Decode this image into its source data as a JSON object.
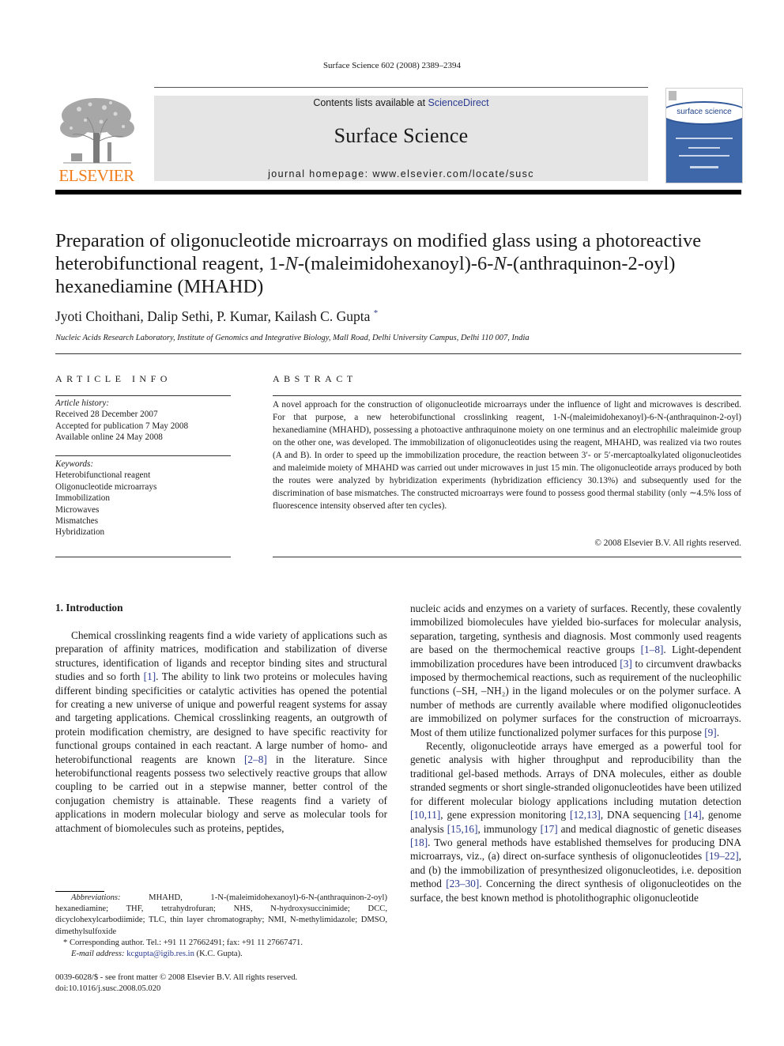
{
  "running_head": "Surface Science 602 (2008) 2389–2394",
  "banner": {
    "contents_prefix": "Contents lists available at ",
    "contents_link": "ScienceDirect",
    "journal_name": "Surface Science",
    "homepage": "journal homepage: www.elsevier.com/locate/susc"
  },
  "publisher_logo": {
    "word": "ELSEVIER",
    "icon": "elsevier-tree-icon",
    "color": "#f07d1a"
  },
  "cover": {
    "title": "surface science",
    "color": "#3d67a8"
  },
  "title_parts": {
    "a": "Preparation of oligonucleotide microarrays on modified glass using a photoreactive heterobifunctional reagent, 1-",
    "n1": "N",
    "b": "-(maleimidohexanoyl)-6-",
    "n2": "N",
    "c": "-(anthraquinon-2-oyl) hexanediamine (MHAHD)"
  },
  "authors": "Jyoti Choithani, Dalip Sethi, P. Kumar, Kailash C. Gupta",
  "author_mark": "*",
  "affiliation": "Nucleic Acids Research Laboratory, Institute of Genomics and Integrative Biology, Mall Road, Delhi University Campus, Delhi 110 007, India",
  "article_info": {
    "heading": "ARTICLE INFO",
    "history_label": "Article history:",
    "history": [
      "Received 28 December 2007",
      "Accepted for publication 7 May 2008",
      "Available online 24 May 2008"
    ],
    "keywords_label": "Keywords:",
    "keywords": [
      "Heterobifunctional reagent",
      "Oligonucleotide microarrays",
      "Immobilization",
      "Microwaves",
      "Mismatches",
      "Hybridization"
    ]
  },
  "abstract": {
    "heading": "ABSTRACT",
    "text": "A novel approach for the construction of oligonucleotide microarrays under the influence of light and microwaves is described. For that purpose, a new heterobifunctional crosslinking reagent, 1-N-(maleimidohexanoyl)-6-N-(anthraquinon-2-oyl) hexanediamine (MHAHD), possessing a photoactive anthraquinone moiety on one terminus and an electrophilic maleimide group on the other one, was developed. The immobilization of oligonucleotides using the reagent, MHAHD, was realized via two routes (A and B). In order to speed up the immobilization procedure, the reaction between 3′- or 5′-mercaptoalkylated oligonucleotides and maleimide moiety of MHAHD was carried out under microwaves in just 15 min. The oligonucleotide arrays produced by both the routes were analyzed by hybridization experiments (hybridization efficiency 30.13%) and subsequently used for the discrimination of base mismatches. The constructed microarrays were found to possess good thermal stability (only ∼4.5% loss of fluorescence intensity observed after ten cycles).",
    "copyright": "© 2008 Elsevier B.V. All rights reserved."
  },
  "introduction": {
    "heading": "1. Introduction",
    "p1": [
      {
        "t": "Chemical crosslinking reagents find a wide variety of applications such as preparation of affinity matrices, modification and stabilization of diverse structures, identification of ligands and receptor binding sites and structural studies and so forth "
      },
      {
        "ref": "[1]"
      },
      {
        "t": ". The ability to link two proteins or molecules having different binding specificities or catalytic activities has opened the potential for creating a new universe of unique and powerful reagent systems for assay and targeting applications. Chemical crosslinking reagents, an outgrowth of protein modification chemistry, are designed to have specific reactivity for functional groups contained in each reactant. A large number of homo- and heterobifunctional reagents are known "
      },
      {
        "ref": "[2–8]"
      },
      {
        "t": " in the literature. Since heterobifunctional reagents possess two selectively reactive groups that allow coupling to be carried out in a stepwise manner, better control of the conjugation chemistry is attainable. These reagents find a variety of applications in modern molecular biology and serve as molecular tools for attachment of biomolecules such as proteins, peptides, nucleic acids and enzymes on a variety of surfaces. Recently, these covalently immobilized biomolecules have yielded bio-surfaces for molecular analysis, separation, targeting, synthesis and diagnosis. Most commonly used reagents are based on the thermochemical reactive groups "
      },
      {
        "ref": "[1–8]"
      },
      {
        "t": ". Light-dependent immobilization procedures have been introduced "
      },
      {
        "ref": "[3]"
      },
      {
        "t": " to circumvent drawbacks imposed by thermochemical reactions, such as requirement of the nucleophilic functions (–SH, –NH₂) in the ligand molecules or on the polymer surface. A number of methods are currently available where modified oligonucleotides are immobilized on polymer surfaces for the construction of microarrays. Most of them utilize functionalized polymer surfaces for this purpose "
      },
      {
        "ref": "[9]"
      },
      {
        "t": "."
      }
    ],
    "p2": [
      {
        "t": "Recently, oligonucleotide arrays have emerged as a powerful tool for genetic analysis with higher throughput and reproducibility than the traditional gel-based methods. Arrays of DNA molecules, either as double stranded segments or short single-stranded oligonucleotides have been utilized for different molecular biology applications including mutation detection "
      },
      {
        "ref": "[10,11]"
      },
      {
        "t": ", gene expression monitoring "
      },
      {
        "ref": "[12,13]"
      },
      {
        "t": ", DNA sequencing "
      },
      {
        "ref": "[14]"
      },
      {
        "t": ", genome analysis "
      },
      {
        "ref": "[15,16]"
      },
      {
        "t": ", immunology "
      },
      {
        "ref": "[17]"
      },
      {
        "t": " and medical diagnostic of genetic diseases "
      },
      {
        "ref": "[18]"
      },
      {
        "t": ". Two general methods have established themselves for producing DNA microarrays, viz., (a) direct on-surface synthesis of oligonucleotides "
      },
      {
        "ref": "[19–22]"
      },
      {
        "t": ", and (b) the immobilization of presynthesized oligonucleotides, i.e. deposition method "
      },
      {
        "ref": "[23–30]"
      },
      {
        "t": ". Concerning the direct synthesis of oligonucleotides on the surface, the best known method is photolithographic oligonucleotide"
      }
    ]
  },
  "footnotes": {
    "abbr_label": "Abbreviations:",
    "abbr_text": " MHAHD, 1-N-(maleimidohexanoyl)-6-N-(anthraquinon-2-oyl) hexanediamine; THF, tetrahydrofuran; NHS, N-hydroxysuccinimide; DCC, dicyclohexylcarbodiimide; TLC, thin layer chromatography; NMI, N-methylimidazole; DMSO, dimethylsulfoxide",
    "corresponding": "* Corresponding author. Tel.: +91 11 27662491; fax: +91 11 27667471.",
    "email_label": "E-mail address:",
    "email": "kcgupta@igib.res.in",
    "email_suffix": " (K.C. Gupta)."
  },
  "front_matter": {
    "issn_line": "0039-6028/$ - see front matter © 2008 Elsevier B.V. All rights reserved.",
    "doi": "doi:10.1016/j.susc.2008.05.020"
  },
  "colors": {
    "link": "#2a3a8f",
    "banner_bg": "#e5e5e5",
    "elsevier_orange": "#f07d1a"
  }
}
